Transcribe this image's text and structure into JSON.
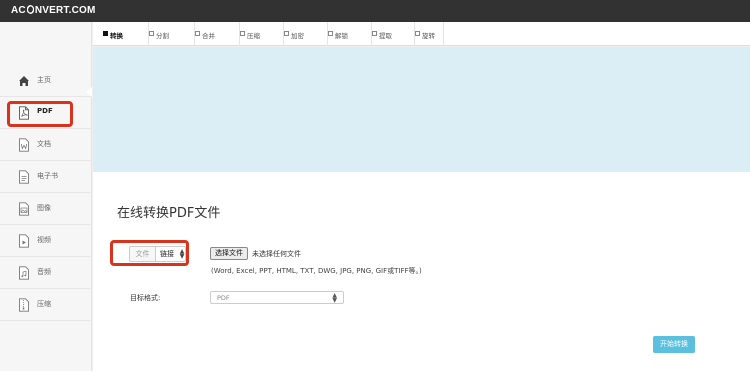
{
  "header": {
    "logo_left": "AC",
    "logo_right": "NVERT.COM",
    "colors": {
      "bar": "#323232",
      "logo_text": "#ffffff"
    }
  },
  "sidebar": {
    "items": [
      {
        "label": "主页",
        "icon": "home-icon",
        "active": false
      },
      {
        "label": "PDF",
        "icon": "pdf-file-icon",
        "active": true
      },
      {
        "label": "文档",
        "icon": "word-document-icon",
        "active": false
      },
      {
        "label": "电子书",
        "icon": "ebook-icon",
        "active": false
      },
      {
        "label": "图像",
        "icon": "image-icon",
        "active": false
      },
      {
        "label": "视频",
        "icon": "video-icon",
        "active": false
      },
      {
        "label": "音频",
        "icon": "audio-icon",
        "active": false
      },
      {
        "label": "压缩",
        "icon": "archive-icon",
        "active": false
      }
    ]
  },
  "tabs": [
    {
      "label": "转换",
      "active": true
    },
    {
      "label": "分割",
      "active": false
    },
    {
      "label": "合并",
      "active": false
    },
    {
      "label": "压缩",
      "active": false
    },
    {
      "label": "加密",
      "active": false
    },
    {
      "label": "解锁",
      "active": false
    },
    {
      "label": "提取",
      "active": false
    },
    {
      "label": "旋转",
      "active": false
    }
  ],
  "main": {
    "heading": "在线转换PDF文件",
    "source_toggle": {
      "file_label": "文件",
      "link_label": "链接",
      "selected": "链接"
    },
    "file_input": {
      "button_label": "选择文件",
      "no_file_text": "未选择任何文件",
      "formats_hint": "(Word, Excel, PPT, HTML, TXT, DWG, JPG, PNG, GIF或TIFF等。)"
    },
    "target_format": {
      "label": "目标格式:",
      "value": "PDF"
    },
    "start_button": "开始转换"
  },
  "colors": {
    "highlight": "#d7331d",
    "banner": "#dbeef5",
    "start_button": "#5bc0de"
  }
}
